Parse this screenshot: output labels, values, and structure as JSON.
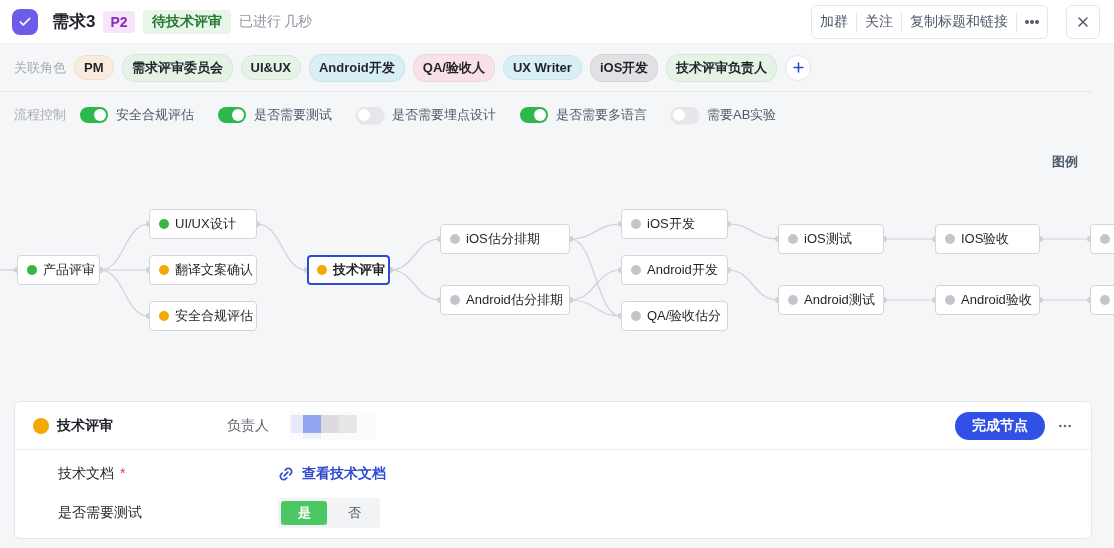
{
  "header": {
    "title": "需求3",
    "priority": "P2",
    "status": "待技术评审",
    "elapsed": "已进行 几秒",
    "actions": [
      "加群",
      "关注",
      "复制标题和链接"
    ]
  },
  "roles": {
    "label": "关联角色",
    "items": [
      {
        "name": "PM",
        "color": "#f9ecdc"
      },
      {
        "name": "需求评审委员会",
        "color": "#e5f3e6"
      },
      {
        "name": "UI&UX",
        "color": "#e5f3e6"
      },
      {
        "name": "Android开发",
        "color": "#d8eff8"
      },
      {
        "name": "QA/验收人",
        "color": "#f9e2e7"
      },
      {
        "name": "UX Writer",
        "color": "#d8eff8"
      },
      {
        "name": "iOS开发",
        "color": "#e1e1e3"
      },
      {
        "name": "技术评审负责人",
        "color": "#e5f3e6"
      }
    ]
  },
  "flow_control": {
    "label": "流程控制",
    "toggles": [
      {
        "label": "安全合规评估",
        "on": true
      },
      {
        "label": "是否需要测试",
        "on": true
      },
      {
        "label": "是否需要埋点设计",
        "on": false
      },
      {
        "label": "是否需要多语言",
        "on": true
      },
      {
        "label": "需要AB实验",
        "on": false
      }
    ]
  },
  "flow": {
    "legend": "图例",
    "nodes": [
      {
        "label": "产品评审",
        "color": "#3ab54a",
        "selected": false
      },
      {
        "label": "UI/UX设计",
        "color": "#3ab54a",
        "selected": false
      },
      {
        "label": "翻译文案确认",
        "color": "#f5a800",
        "selected": false
      },
      {
        "label": "安全合规评估",
        "color": "#f5a800",
        "selected": false
      },
      {
        "label": "技术评审",
        "color": "#f5a800",
        "selected": true
      },
      {
        "label": "iOS估分排期",
        "color": "#c4c4cc",
        "selected": false
      },
      {
        "label": "Android估分排期",
        "color": "#c4c4cc",
        "selected": false
      },
      {
        "label": "iOS开发",
        "color": "#c4c4cc",
        "selected": false
      },
      {
        "label": "Android开发",
        "color": "#c4c4cc",
        "selected": false
      },
      {
        "label": "QA/验收估分",
        "color": "#c4c4cc",
        "selected": false
      },
      {
        "label": "iOS测试",
        "color": "#c4c4cc",
        "selected": false
      },
      {
        "label": "Android测试",
        "color": "#c4c4cc",
        "selected": false
      },
      {
        "label": "IOS验收",
        "color": "#c4c4cc",
        "selected": false
      },
      {
        "label": "Android验收",
        "color": "#c4c4cc",
        "selected": false
      },
      {
        "color": "#c4c4cc",
        "selected": false
      },
      {
        "color": "#c4c4cc",
        "selected": false
      }
    ]
  },
  "detail": {
    "node": "技术评审",
    "color": "#f5a800",
    "owner_label": "负责人",
    "complete_button": "完成节点",
    "fields": [
      {
        "kind": "link",
        "label": "技术文档",
        "required_mark": "*",
        "value": "查看技术文档"
      },
      {
        "kind": "choice",
        "label": "是否需要测试",
        "options": [
          {
            "label": "是",
            "selected": true
          },
          {
            "label": "否",
            "selected": false
          }
        ]
      }
    ]
  }
}
